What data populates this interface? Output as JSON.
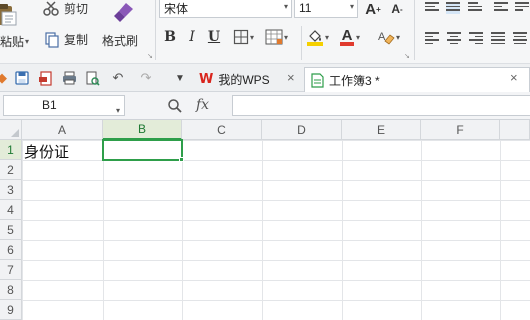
{
  "ribbon": {
    "clipboard": {
      "paste": "粘贴",
      "cut": "剪切",
      "copy": "复制",
      "format_painter": "格式刷"
    },
    "font": {
      "family": "宋体",
      "size": "11",
      "bold": "B",
      "italic": "I",
      "underline": "U",
      "grow": "A",
      "shrink": "A",
      "font_color_glyph": "A"
    },
    "colors": {
      "accent_green": "#2e9e4a",
      "font_color_red": "#e03a2e",
      "fill_yellow": "#f5d000"
    }
  },
  "tabs": [
    {
      "label": "我的WPS",
      "icon": "wps-logo-icon",
      "active": false
    },
    {
      "label": "工作簿3 *",
      "icon": "spreadsheet-doc-icon",
      "active": true
    }
  ],
  "formula_bar": {
    "name_box": "B1",
    "fx_label": "fx",
    "value": ""
  },
  "sheet": {
    "columns": [
      "A",
      "B",
      "C",
      "D",
      "E",
      "F"
    ],
    "rows": [
      "1",
      "2",
      "3",
      "4",
      "5",
      "6",
      "7",
      "8",
      "9"
    ],
    "selected_cell": "B1",
    "cells": [
      {
        "ref": "A1",
        "value": "身份证"
      }
    ]
  }
}
